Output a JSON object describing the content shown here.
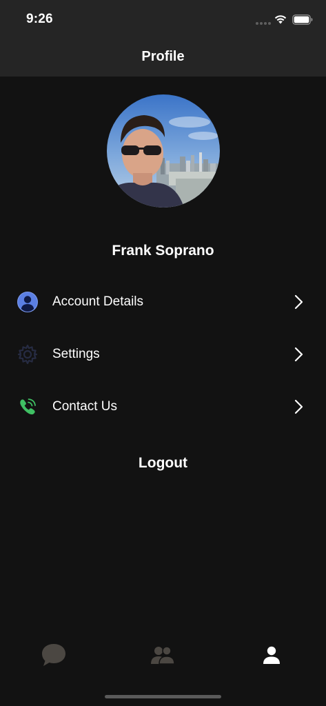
{
  "status_bar": {
    "time": "9:26"
  },
  "nav": {
    "title": "Profile"
  },
  "profile": {
    "name": "Frank Soprano"
  },
  "menu": [
    {
      "label": "Account Details",
      "icon": "user-circle-icon"
    },
    {
      "label": "Settings",
      "icon": "gear-icon"
    },
    {
      "label": "Contact Us",
      "icon": "phone-ringing-icon"
    }
  ],
  "logout_label": "Logout",
  "tab_bar": {
    "items": [
      {
        "name": "chats",
        "icon": "chat-bubble-icon",
        "active": false
      },
      {
        "name": "contacts",
        "icon": "people-icon",
        "active": false
      },
      {
        "name": "profile",
        "icon": "person-icon",
        "active": true
      }
    ]
  },
  "colors": {
    "background": "#121212",
    "top_bar": "#252525",
    "account_icon": "#5b7fe3",
    "contact_icon": "#3fbf63",
    "settings_icon": "#1f2438",
    "tab_inactive": "#4b4742",
    "tab_active": "#ffffff"
  }
}
